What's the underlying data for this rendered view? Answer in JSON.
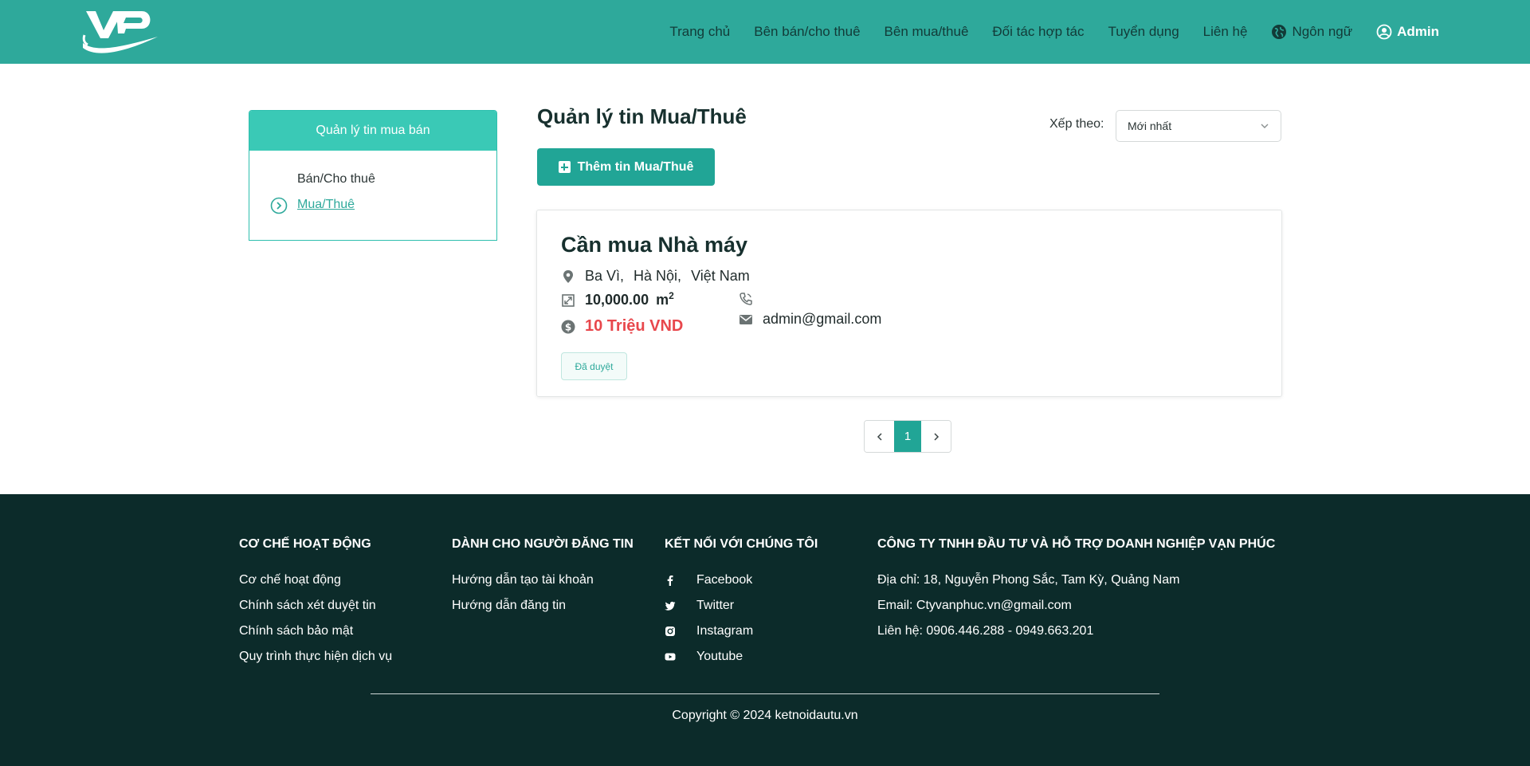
{
  "colors": {
    "header_bg": "#2ea99b",
    "accent": "#21a596",
    "price": "#e8474c",
    "footer_bg": "#0c2b2a"
  },
  "nav": {
    "items": [
      "Trang chủ",
      "Bên bán/cho thuê",
      "Bên mua/thuê",
      "Đối tác hợp tác",
      "Tuyển dụng",
      "Liên hệ"
    ],
    "language": "Ngôn ngữ",
    "user": "Admin"
  },
  "sidebar": {
    "title": "Quản lý tin mua bán",
    "items": [
      "Bán/Cho thuê",
      "Mua/Thuê"
    ],
    "active": "Mua/Thuê"
  },
  "main": {
    "title": "Quản lý tin Mua/Thuê",
    "add_button": "Thêm tin Mua/Thuê",
    "sort_label": "Xếp theo:",
    "sort_value": "Mới nhất"
  },
  "listing": {
    "title": "Cần mua Nhà máy",
    "location": [
      "Ba Vì,",
      "Hà Nội,",
      "Việt Nam"
    ],
    "area": "10,000.00",
    "area_unit": "m",
    "area_sup": "2",
    "price": "10 Triệu VND",
    "phone": "",
    "email": "admin@gmail.com",
    "status": "Đã duyệt"
  },
  "pagination": {
    "current": "1"
  },
  "footer": {
    "col1": {
      "title": "CƠ CHẾ HOẠT ĐỘNG",
      "links": [
        "Cơ chế hoạt động",
        "Chính sách xét duyệt tin",
        "Chính sách bảo mật",
        "Quy trình thực hiện dịch vụ"
      ]
    },
    "col2": {
      "title": "DÀNH CHO NGƯỜI ĐĂNG TIN",
      "links": [
        "Hướng dẫn tạo tài khoản",
        "Hướng dẫn đăng tin"
      ]
    },
    "col3": {
      "title": "KẾT NỐI VỚI CHÚNG TÔI",
      "links": [
        "Facebook",
        "Twitter",
        "Instagram",
        "Youtube"
      ]
    },
    "col4": {
      "title": "CÔNG TY TNHH ĐẦU TƯ VÀ HỖ TRỢ DOANH NGHIỆP VẠN PHÚC",
      "lines": [
        "Địa chỉ: 18, Nguyễn Phong Sắc, Tam Kỳ, Quảng Nam",
        "Email: Ctyvanphuc.vn@gmail.com",
        "Liên hệ: 0906.446.288 - 0949.663.201"
      ]
    },
    "copyright": "Copyright © 2024 ketnoidautu.vn"
  }
}
